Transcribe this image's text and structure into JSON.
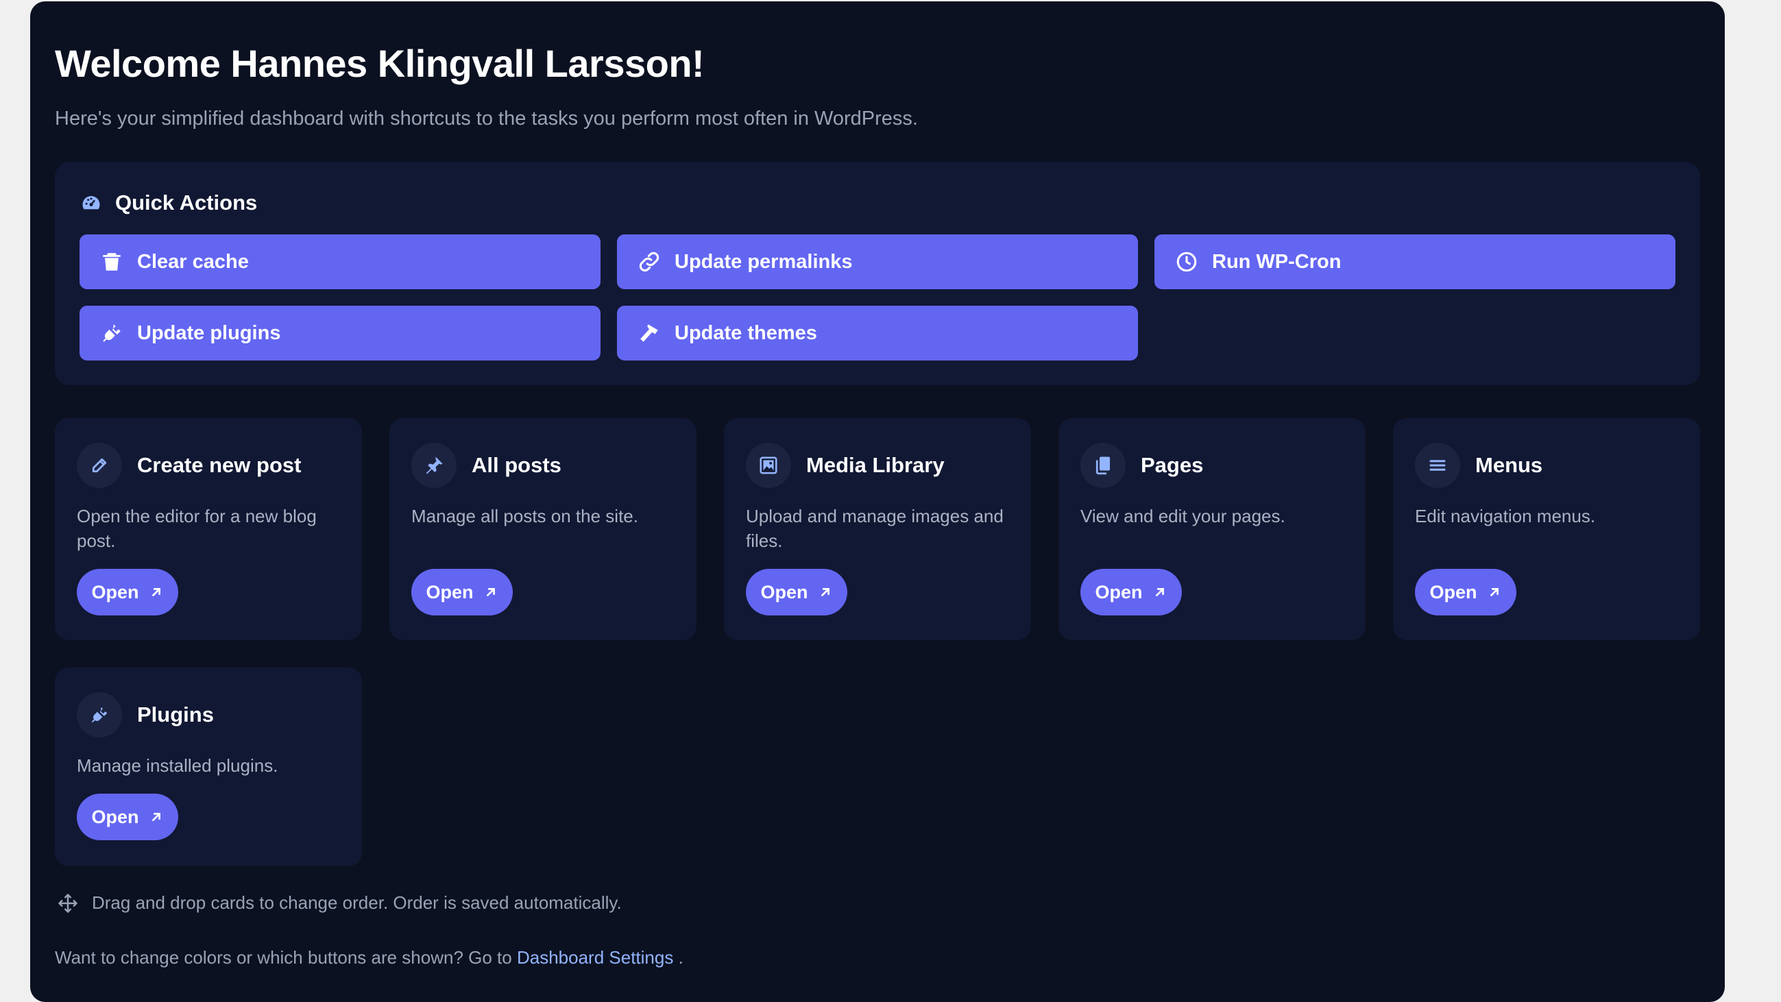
{
  "header": {
    "title": "Welcome Hannes Klingvall Larsson!",
    "subtitle": "Here's your simplified dashboard with shortcuts to the tasks you perform most often in WordPress."
  },
  "quick_actions": {
    "title": "Quick Actions",
    "icon": "gauge-icon",
    "buttons": [
      {
        "label": "Clear cache",
        "icon": "trash-icon"
      },
      {
        "label": "Update permalinks",
        "icon": "link-icon"
      },
      {
        "label": "Run WP-Cron",
        "icon": "clock-icon"
      },
      {
        "label": "Update plugins",
        "icon": "plug-icon"
      },
      {
        "label": "Update themes",
        "icon": "hammer-icon"
      }
    ]
  },
  "cards": [
    {
      "title": "Create new post",
      "description": "Open the editor for a new blog post.",
      "button": "Open",
      "icon": "pencil-icon"
    },
    {
      "title": "All posts",
      "description": "Manage all posts on the site.",
      "button": "Open",
      "icon": "pin-icon"
    },
    {
      "title": "Media Library",
      "description": "Upload and manage images and files.",
      "button": "Open",
      "icon": "image-icon"
    },
    {
      "title": "Pages",
      "description": "View and edit your pages.",
      "button": "Open",
      "icon": "pages-icon"
    },
    {
      "title": "Menus",
      "description": "Edit navigation menus.",
      "button": "Open",
      "icon": "menu-icon"
    },
    {
      "title": "Plugins",
      "description": "Manage installed plugins.",
      "button": "Open",
      "icon": "plug-icon"
    }
  ],
  "hint": "Drag and drop cards to change order. Order is saved automatically.",
  "footer": {
    "prefix": "Want to change colors or which buttons are shown? Go to",
    "link_label": "Dashboard Settings",
    "suffix": "."
  },
  "colors": {
    "accent": "#6366f1",
    "background": "#0b1120",
    "card": "#111833",
    "link": "#93b4ff"
  }
}
